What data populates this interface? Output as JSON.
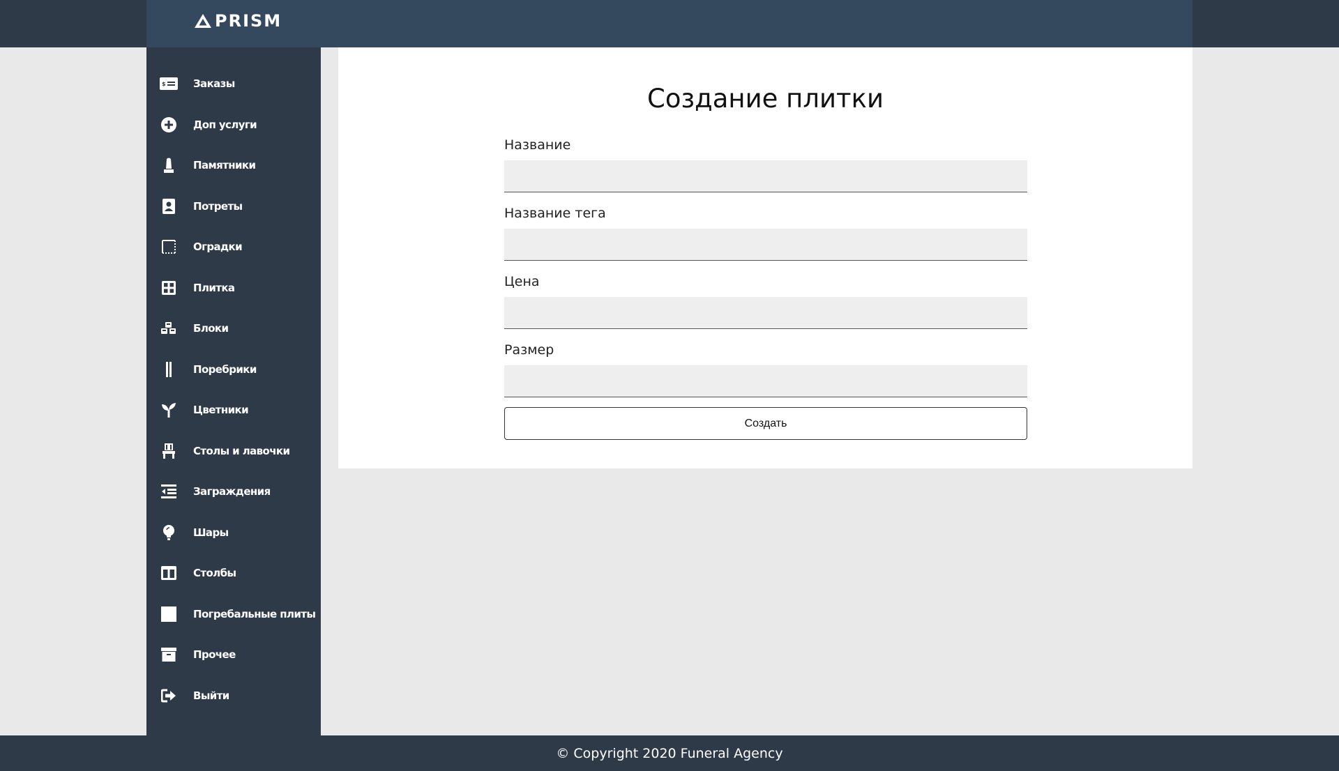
{
  "header": {
    "logo_text": "PRISM"
  },
  "sidebar": {
    "items": [
      {
        "label": "Заказы",
        "icon": "money-card-icon"
      },
      {
        "label": "Доп услуги",
        "icon": "plus-circle-icon"
      },
      {
        "label": "Памятники",
        "icon": "monument-icon"
      },
      {
        "label": "Потреты",
        "icon": "portrait-icon"
      },
      {
        "label": "Оградки",
        "icon": "fence-square-icon"
      },
      {
        "label": "Плитка",
        "icon": "grid-tile-icon"
      },
      {
        "label": "Блоки",
        "icon": "cubes-icon"
      },
      {
        "label": "Поребрики",
        "icon": "vertical-bars-icon"
      },
      {
        "label": "Цветники",
        "icon": "seedling-icon"
      },
      {
        "label": "Столы и лавочки",
        "icon": "chair-icon"
      },
      {
        "label": "Заграждения",
        "icon": "indent-list-icon"
      },
      {
        "label": "Шары",
        "icon": "lightbulb-icon"
      },
      {
        "label": "Столбы",
        "icon": "columns-icon"
      },
      {
        "label": "Погребальные плиты",
        "icon": "square-slab-icon"
      },
      {
        "label": "Прочее",
        "icon": "archive-box-icon"
      },
      {
        "label": "Выйти",
        "icon": "sign-out-icon"
      }
    ]
  },
  "form": {
    "title": "Создание плитки",
    "fields": [
      {
        "label": "Название",
        "value": "",
        "placeholder": ""
      },
      {
        "label": "Название тега",
        "value": "",
        "placeholder": ""
      },
      {
        "label": "Цена",
        "value": "",
        "placeholder": ""
      },
      {
        "label": "Размер",
        "value": "",
        "placeholder": ""
      }
    ],
    "submit_label": "Создать"
  },
  "footer": {
    "text": "© Copyright 2020 Funeral Agency"
  },
  "colors": {
    "topbar": "#2e3a48",
    "topbar_inner": "#34495e",
    "sidebar": "#2e3a48",
    "page_bg": "#e9e9e9",
    "panel_bg": "#ffffff",
    "input_bg": "#eeeeee"
  }
}
